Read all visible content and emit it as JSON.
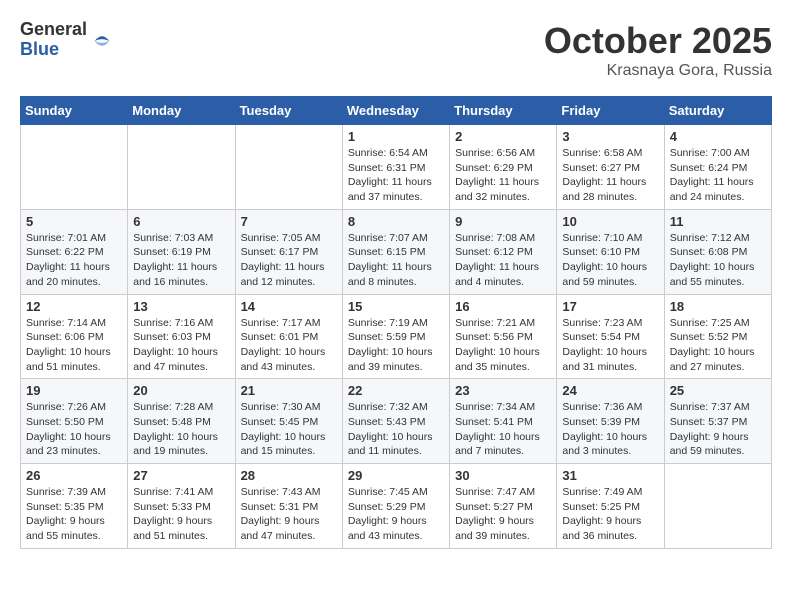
{
  "header": {
    "logo": {
      "line1": "General",
      "line2": "Blue"
    },
    "title": "October 2025",
    "location": "Krasnaya Gora, Russia"
  },
  "days_of_week": [
    "Sunday",
    "Monday",
    "Tuesday",
    "Wednesday",
    "Thursday",
    "Friday",
    "Saturday"
  ],
  "weeks": [
    [
      {
        "day": "",
        "info": ""
      },
      {
        "day": "",
        "info": ""
      },
      {
        "day": "",
        "info": ""
      },
      {
        "day": "1",
        "info": "Sunrise: 6:54 AM\nSunset: 6:31 PM\nDaylight: 11 hours\nand 37 minutes."
      },
      {
        "day": "2",
        "info": "Sunrise: 6:56 AM\nSunset: 6:29 PM\nDaylight: 11 hours\nand 32 minutes."
      },
      {
        "day": "3",
        "info": "Sunrise: 6:58 AM\nSunset: 6:27 PM\nDaylight: 11 hours\nand 28 minutes."
      },
      {
        "day": "4",
        "info": "Sunrise: 7:00 AM\nSunset: 6:24 PM\nDaylight: 11 hours\nand 24 minutes."
      }
    ],
    [
      {
        "day": "5",
        "info": "Sunrise: 7:01 AM\nSunset: 6:22 PM\nDaylight: 11 hours\nand 20 minutes."
      },
      {
        "day": "6",
        "info": "Sunrise: 7:03 AM\nSunset: 6:19 PM\nDaylight: 11 hours\nand 16 minutes."
      },
      {
        "day": "7",
        "info": "Sunrise: 7:05 AM\nSunset: 6:17 PM\nDaylight: 11 hours\nand 12 minutes."
      },
      {
        "day": "8",
        "info": "Sunrise: 7:07 AM\nSunset: 6:15 PM\nDaylight: 11 hours\nand 8 minutes."
      },
      {
        "day": "9",
        "info": "Sunrise: 7:08 AM\nSunset: 6:12 PM\nDaylight: 11 hours\nand 4 minutes."
      },
      {
        "day": "10",
        "info": "Sunrise: 7:10 AM\nSunset: 6:10 PM\nDaylight: 10 hours\nand 59 minutes."
      },
      {
        "day": "11",
        "info": "Sunrise: 7:12 AM\nSunset: 6:08 PM\nDaylight: 10 hours\nand 55 minutes."
      }
    ],
    [
      {
        "day": "12",
        "info": "Sunrise: 7:14 AM\nSunset: 6:06 PM\nDaylight: 10 hours\nand 51 minutes."
      },
      {
        "day": "13",
        "info": "Sunrise: 7:16 AM\nSunset: 6:03 PM\nDaylight: 10 hours\nand 47 minutes."
      },
      {
        "day": "14",
        "info": "Sunrise: 7:17 AM\nSunset: 6:01 PM\nDaylight: 10 hours\nand 43 minutes."
      },
      {
        "day": "15",
        "info": "Sunrise: 7:19 AM\nSunset: 5:59 PM\nDaylight: 10 hours\nand 39 minutes."
      },
      {
        "day": "16",
        "info": "Sunrise: 7:21 AM\nSunset: 5:56 PM\nDaylight: 10 hours\nand 35 minutes."
      },
      {
        "day": "17",
        "info": "Sunrise: 7:23 AM\nSunset: 5:54 PM\nDaylight: 10 hours\nand 31 minutes."
      },
      {
        "day": "18",
        "info": "Sunrise: 7:25 AM\nSunset: 5:52 PM\nDaylight: 10 hours\nand 27 minutes."
      }
    ],
    [
      {
        "day": "19",
        "info": "Sunrise: 7:26 AM\nSunset: 5:50 PM\nDaylight: 10 hours\nand 23 minutes."
      },
      {
        "day": "20",
        "info": "Sunrise: 7:28 AM\nSunset: 5:48 PM\nDaylight: 10 hours\nand 19 minutes."
      },
      {
        "day": "21",
        "info": "Sunrise: 7:30 AM\nSunset: 5:45 PM\nDaylight: 10 hours\nand 15 minutes."
      },
      {
        "day": "22",
        "info": "Sunrise: 7:32 AM\nSunset: 5:43 PM\nDaylight: 10 hours\nand 11 minutes."
      },
      {
        "day": "23",
        "info": "Sunrise: 7:34 AM\nSunset: 5:41 PM\nDaylight: 10 hours\nand 7 minutes."
      },
      {
        "day": "24",
        "info": "Sunrise: 7:36 AM\nSunset: 5:39 PM\nDaylight: 10 hours\nand 3 minutes."
      },
      {
        "day": "25",
        "info": "Sunrise: 7:37 AM\nSunset: 5:37 PM\nDaylight: 9 hours\nand 59 minutes."
      }
    ],
    [
      {
        "day": "26",
        "info": "Sunrise: 7:39 AM\nSunset: 5:35 PM\nDaylight: 9 hours\nand 55 minutes."
      },
      {
        "day": "27",
        "info": "Sunrise: 7:41 AM\nSunset: 5:33 PM\nDaylight: 9 hours\nand 51 minutes."
      },
      {
        "day": "28",
        "info": "Sunrise: 7:43 AM\nSunset: 5:31 PM\nDaylight: 9 hours\nand 47 minutes."
      },
      {
        "day": "29",
        "info": "Sunrise: 7:45 AM\nSunset: 5:29 PM\nDaylight: 9 hours\nand 43 minutes."
      },
      {
        "day": "30",
        "info": "Sunrise: 7:47 AM\nSunset: 5:27 PM\nDaylight: 9 hours\nand 39 minutes."
      },
      {
        "day": "31",
        "info": "Sunrise: 7:49 AM\nSunset: 5:25 PM\nDaylight: 9 hours\nand 36 minutes."
      },
      {
        "day": "",
        "info": ""
      }
    ]
  ]
}
